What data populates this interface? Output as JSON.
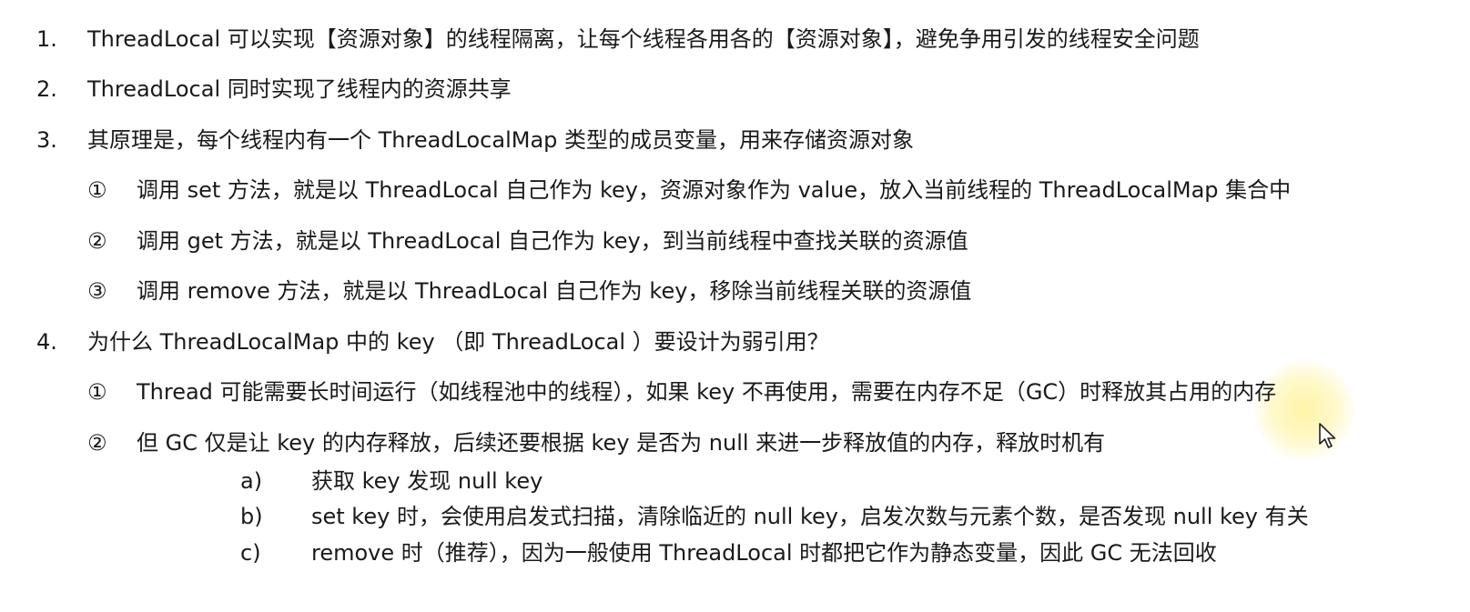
{
  "items": [
    {
      "num": "1.",
      "text": "ThreadLocal 可以实现【资源对象】的线程隔离，让每个线程各用各的【资源对象】，避免争用引发的线程安全问题"
    },
    {
      "num": "2.",
      "text": "ThreadLocal 同时实现了线程内的资源共享"
    },
    {
      "num": "3.",
      "text": "其原理是，每个线程内有一个 ThreadLocalMap 类型的成员变量，用来存储资源对象"
    },
    {
      "num": "①",
      "text": "调用 set 方法，就是以 ThreadLocal 自己作为 key，资源对象作为 value，放入当前线程的 ThreadLocalMap 集合中"
    },
    {
      "num": "②",
      "text": "调用 get 方法，就是以 ThreadLocal 自己作为 key，到当前线程中查找关联的资源值"
    },
    {
      "num": "③",
      "text": "调用 remove 方法，就是以 ThreadLocal 自己作为 key，移除当前线程关联的资源值"
    },
    {
      "num": "4.",
      "text": "为什么 ThreadLocalMap 中的 key （即 ThreadLocal ）要设计为弱引用？"
    },
    {
      "num": "①",
      "text": "Thread 可能需要长时间运行（如线程池中的线程），如果 key 不再使用，需要在内存不足（GC）时释放其占用的内存"
    },
    {
      "num": "②",
      "text": "但 GC 仅是让 key 的内存释放，后续还要根据 key 是否为 null 来进一步释放值的内存，释放时机有"
    },
    {
      "num": "a)",
      "text": "获取 key 发现 null key"
    },
    {
      "num": "b)",
      "text": "set key 时，会使用启发式扫描，清除临近的 null key，启发次数与元素个数，是否发现 null key 有关"
    },
    {
      "num": "c)",
      "text": "remove 时（推荐），因为一般使用 ThreadLocal 时都把它作为静态变量，因此 GC 无法回收"
    }
  ],
  "cursor": {
    "icon": "mouse-pointer-icon",
    "highlight_color": "#fff29a"
  }
}
